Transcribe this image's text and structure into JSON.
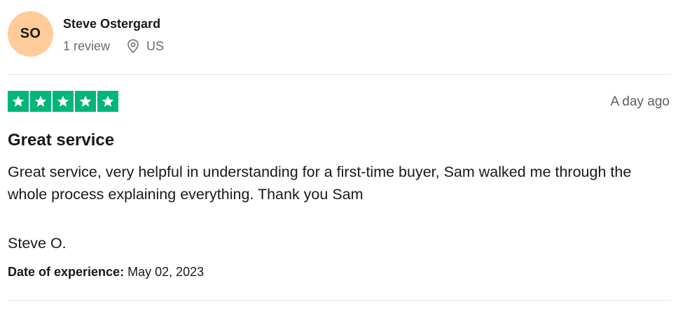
{
  "consumer": {
    "initials": "SO",
    "name": "Steve Ostergard",
    "review_count": "1 review",
    "location": "US",
    "location_icon": "map-pin-icon",
    "avatar_color": "#ffcc99"
  },
  "review": {
    "rating": 5,
    "rating_max": 5,
    "star_color": "#00b67a",
    "date": "A day ago",
    "title": "Great service",
    "text": "Great service, very helpful in understanding for a first-time buyer, Sam walked me through the whole process explaining everything. Thank you Sam",
    "signature": "Steve O.",
    "experience_label": "Date of experience:",
    "experience_date": "May 02, 2023"
  }
}
